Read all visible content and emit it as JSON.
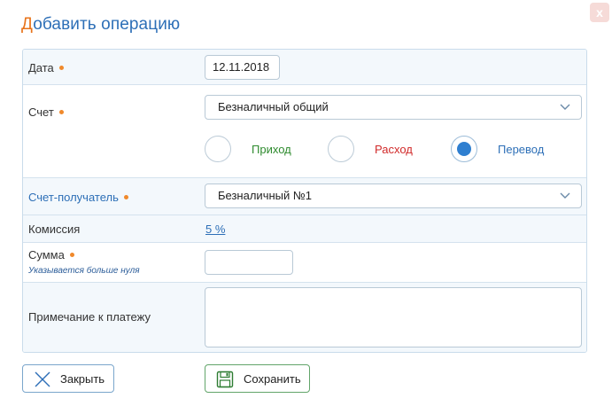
{
  "dialog": {
    "title_first_letter": "Д",
    "title_rest": "обавить операцию",
    "close_glyph": "x"
  },
  "fields": {
    "date": {
      "label": "Дата",
      "value": "12.11.2018",
      "required": true
    },
    "account": {
      "label": "Счет",
      "value": "Безналичный общий",
      "required": true
    },
    "type": {
      "options": [
        {
          "label": "Приход",
          "color": "#2e8b2e",
          "checked": false
        },
        {
          "label": "Расход",
          "color": "#d12a2a",
          "checked": false
        },
        {
          "label": "Перевод",
          "color": "#2d6fb7",
          "checked": true
        }
      ]
    },
    "target_account": {
      "label": "Счет-получатель",
      "value": "Безналичный №1",
      "required": true
    },
    "commission": {
      "label": "Комиссия",
      "value": "5 %"
    },
    "amount": {
      "label": "Сумма",
      "hint": "Указывается больше нуля",
      "value": "",
      "required": true
    },
    "note": {
      "label": "Примечание к платежу",
      "value": ""
    }
  },
  "buttons": {
    "close_label": "Закрыть",
    "save_label": "Сохранить"
  },
  "colors": {
    "accent_blue": "#2d6fb7",
    "required_dot": "#f0892b",
    "title_first": "#e8731a"
  },
  "icons": {
    "close": "close-x-icon",
    "save": "floppy-disk-icon",
    "select": "chevron-down-icon"
  }
}
